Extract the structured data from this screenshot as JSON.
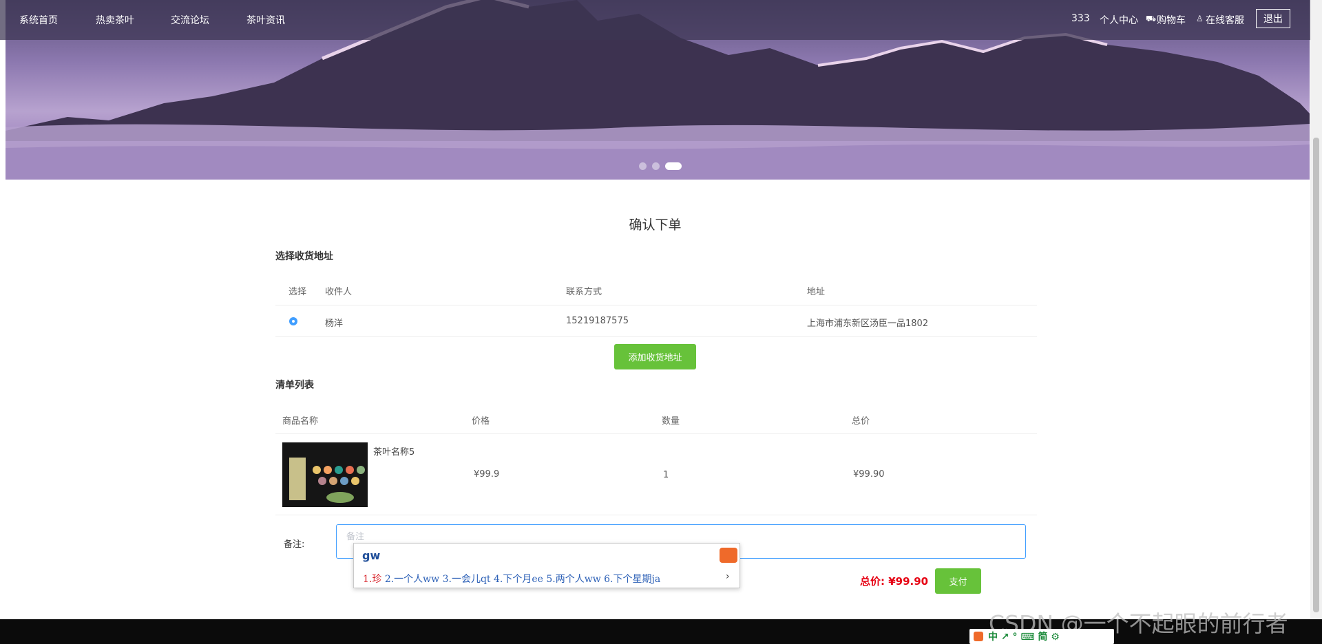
{
  "nav": {
    "items": [
      "系统首页",
      "热卖茶叶",
      "交流论坛",
      "茶叶资讯"
    ],
    "username": "333",
    "user_center": "个人中心",
    "cart": "购物车",
    "service": "在线客服",
    "logout": "退出"
  },
  "page_title": "确认下单",
  "address": {
    "section_title": "选择收货地址",
    "headers": [
      "选择",
      "收件人",
      "联系方式",
      "地址"
    ],
    "rows": [
      {
        "selected": true,
        "recipient": "杨洋",
        "phone": "15219187575",
        "address": "上海市浦东新区汤臣一品1802"
      }
    ],
    "add_button": "添加收货地址"
  },
  "order": {
    "section_title": "清单列表",
    "headers": [
      "商品名称",
      "价格",
      "数量",
      "总价"
    ],
    "items": [
      {
        "name": "茶叶名称5",
        "price": "¥99.9",
        "quantity": "1",
        "subtotal": "¥99.90"
      }
    ]
  },
  "remark": {
    "label": "备注:",
    "placeholder": "备注"
  },
  "summary": {
    "total_label": "总价:",
    "total_value": "¥99.90",
    "pay_button": "支付"
  },
  "ime": {
    "code": "gw",
    "first_candidate": "1.珍",
    "other_candidates": "2.一个人ww 3.一会儿qt 4.下个月ee 5.两个人ww 6.下个星期ja",
    "toolbar": "中 ↗ ° ⌨ 简 ⚙"
  },
  "watermark": "CSDN @一个不起眼的前行者",
  "carousel": {
    "count": 3,
    "active": 3
  },
  "colors": {
    "accent": "#67c23a",
    "primary": "#409eff",
    "price": "#e60012"
  }
}
